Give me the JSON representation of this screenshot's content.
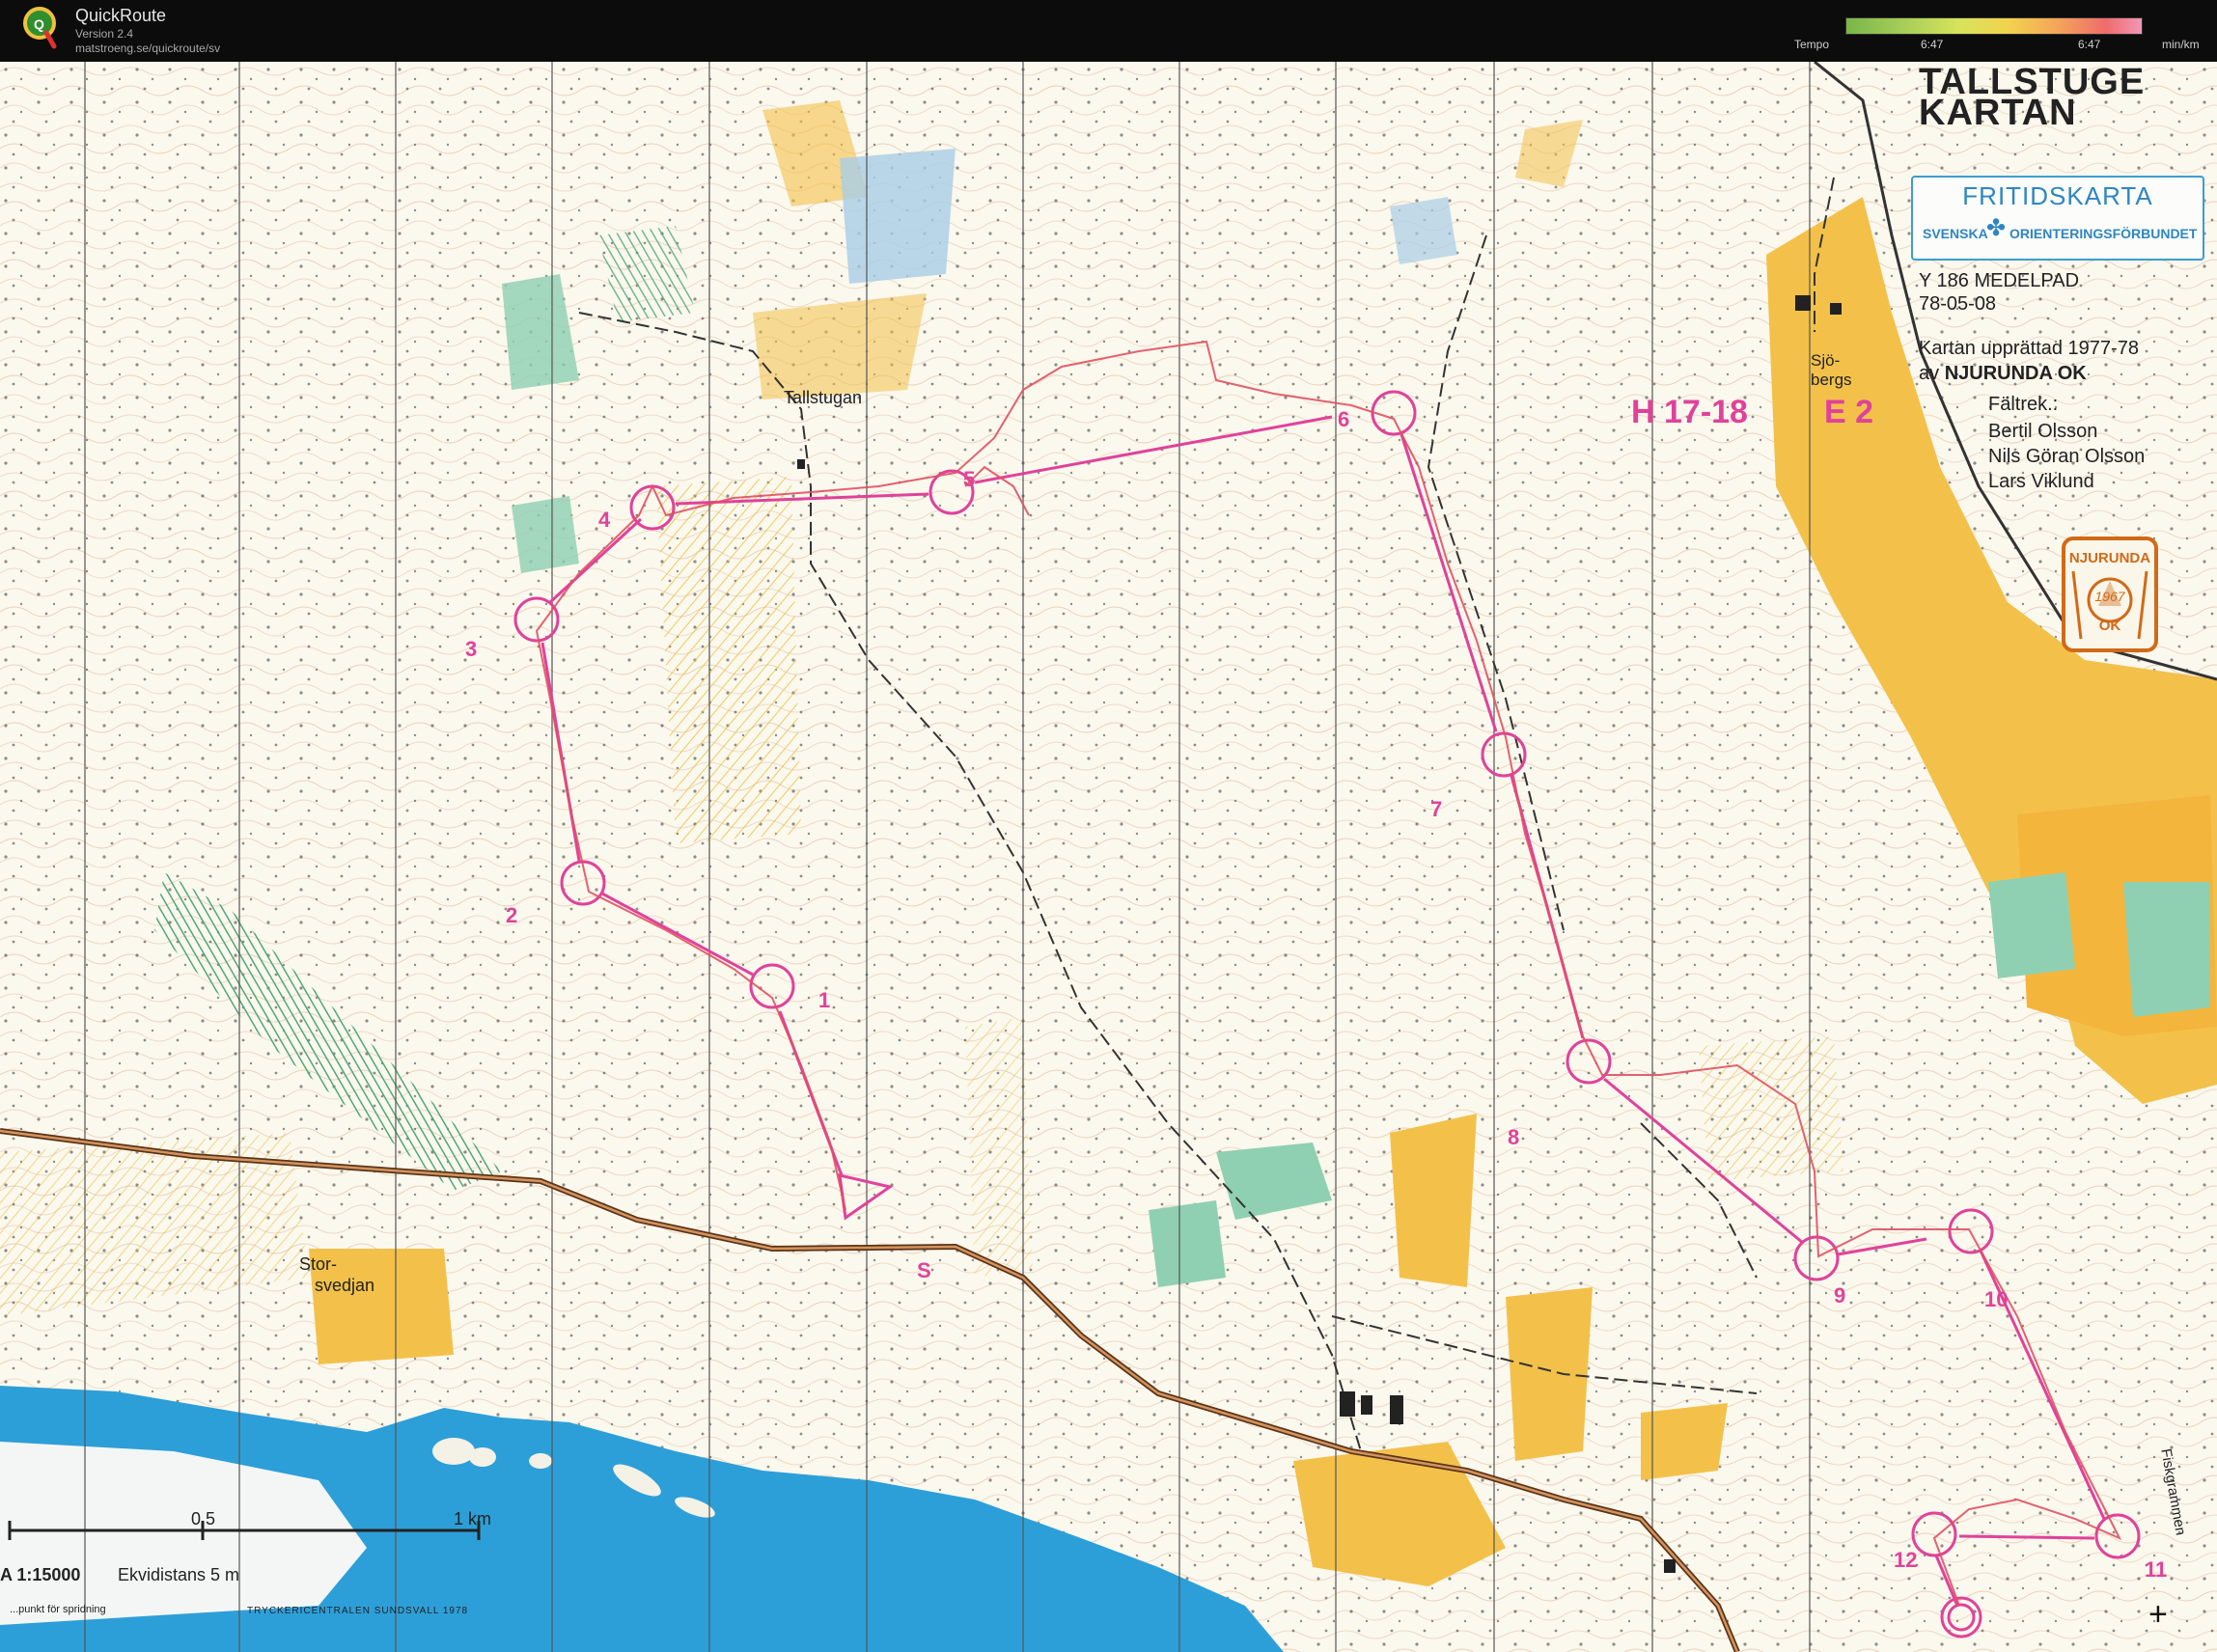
{
  "app": {
    "title": "QuickRoute",
    "version": "Version 2.4",
    "url": "matstroeng.se/quickroute/sv",
    "logo_icon": "quickroute-logo-icon"
  },
  "tempo_scale": {
    "label": "Tempo",
    "min_value": "6:47",
    "max_value": "6:47",
    "unit": "min/km",
    "colors": [
      "#7ab648",
      "#d7e35b",
      "#f3d24e",
      "#f4a35a",
      "#ef6c6c",
      "#f097b6"
    ]
  },
  "map": {
    "title_line1": "TALLSTUGE",
    "title_line2": "KARTAN",
    "fritidskarta": "FRITIDSKARTA",
    "svenska": "SVENSKA",
    "orienteringsforbundet": "ORIENTERINGSFÖRBUNDET",
    "map_code": "Y 186 MEDELPAD",
    "map_date": "78-05-08",
    "created": "Kartan upprättad 1977-78",
    "av": "av",
    "club": "NJURUNDA OK",
    "faltrek_label": "Fältrek.:",
    "faltrek": [
      "Bertil Olsson",
      "Nils Göran Olsson",
      "Lars Viklund"
    ],
    "club_logo_name": "NJURUNDA",
    "club_logo_year": "1967",
    "club_logo_ok": "OK",
    "class_label": "H 17-18",
    "class_e": "E 2",
    "place_tallstugan": "Tallstugan",
    "place_sjobergs_1": "Sjö-",
    "place_sjobergs_2": "bergs",
    "place_storsvedjan_1": "Stor-",
    "place_storsvedjan_2": "svedjan",
    "place_fiskgrammen": "Fiskgrammen",
    "scale_05": "0,5",
    "scale_1km": "1 km",
    "scale_ratio": "A 1:15000",
    "equidistance": "Ekvidistans 5 m",
    "fineprint_left": "...punkt för spridning",
    "fineprint_right": "TRYCKERICENTRALEN SUNDSVALL 1978",
    "start_label": "S",
    "controls": [
      {
        "label": "1"
      },
      {
        "label": "2"
      },
      {
        "label": "3"
      },
      {
        "label": "4"
      },
      {
        "label": "5"
      },
      {
        "label": "6"
      },
      {
        "label": "7"
      },
      {
        "label": "8"
      },
      {
        "label": "9"
      },
      {
        "label": "10"
      },
      {
        "label": "11"
      },
      {
        "label": "12"
      }
    ],
    "course_color": "#e0429a",
    "route_color": "#e05060",
    "water_color": "#2d9fd8",
    "open_land_color": "#f0c040"
  },
  "toolbar": {
    "crosshair_icon": "crosshair-icon"
  }
}
